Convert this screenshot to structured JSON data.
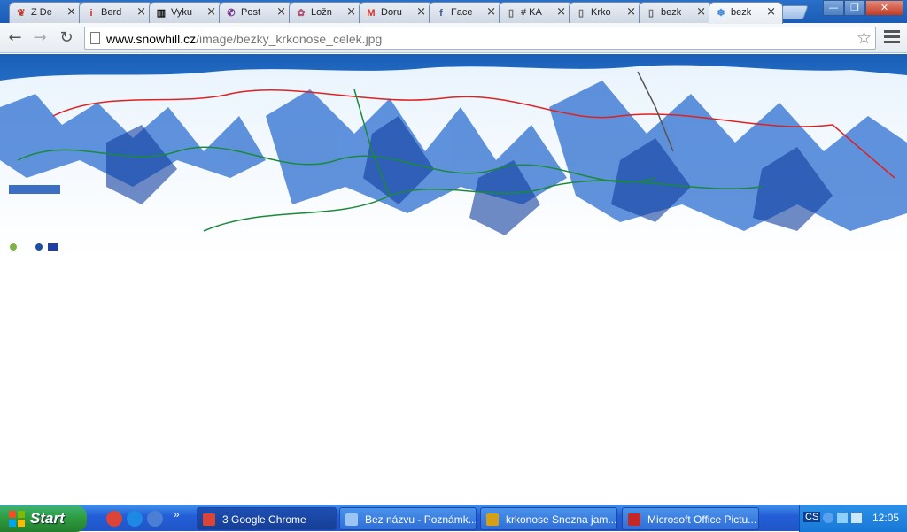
{
  "browser": {
    "tabs": [
      {
        "title": "Z De",
        "icon": "bookmark-icon",
        "icon_glyph": "❦",
        "icon_color": "#c0392b"
      },
      {
        "title": "Berd",
        "icon": "info-icon",
        "icon_glyph": "i",
        "icon_color": "#d32f2f"
      },
      {
        "title": "Vyku",
        "icon": "barcode-icon",
        "icon_glyph": "▥",
        "icon_color": "#000000"
      },
      {
        "title": "Post",
        "icon": "viber-icon",
        "icon_glyph": "✆",
        "icon_color": "#7b2a8e"
      },
      {
        "title": "Ložn",
        "icon": "pig-icon",
        "icon_glyph": "✿",
        "icon_color": "#b05070"
      },
      {
        "title": "Doru",
        "icon": "gmail-icon",
        "icon_glyph": "M",
        "icon_color": "#d93025"
      },
      {
        "title": "Face",
        "icon": "facebook-icon",
        "icon_glyph": "f",
        "icon_color": "#3b5998"
      },
      {
        "title": "# KA",
        "icon": "page-icon",
        "icon_glyph": "▯",
        "icon_color": "#666666"
      },
      {
        "title": "Krko",
        "icon": "page-icon",
        "icon_glyph": "▯",
        "icon_color": "#666666"
      },
      {
        "title": "bezk",
        "icon": "page-icon",
        "icon_glyph": "▯",
        "icon_color": "#666666"
      },
      {
        "title": "bezk",
        "icon": "snowflake-icon",
        "icon_glyph": "❄",
        "icon_color": "#2a7fd4",
        "active": true
      }
    ],
    "url_host": "www.snowhill.cz",
    "url_path": "/image/bezky_krkonose_celek.jpg",
    "window_controls": {
      "minimize": "—",
      "restore": "❐",
      "close": "✕"
    }
  },
  "taskbar": {
    "start_label": "Start",
    "quick_launch": [
      {
        "icon": "chrome-icon",
        "color": "#db4437"
      },
      {
        "icon": "ie-icon",
        "color": "#1e88e5"
      },
      {
        "icon": "ie-alt-icon",
        "color": "#4a7fd4"
      }
    ],
    "overflow": "»",
    "tasks": [
      {
        "label": "3  Google Chrome",
        "icon": "chrome-icon",
        "color": "#db4437",
        "active": true
      },
      {
        "label": "Bez názvu - Poznámk...",
        "icon": "notepad-icon",
        "color": "#9cc4f0"
      },
      {
        "label": "krkonose Snezna jam...",
        "icon": "image-icon",
        "color": "#d4a017"
      },
      {
        "label": "Microsoft Office Pictu...",
        "icon": "office-picture-icon",
        "color": "#c62828"
      }
    ],
    "lang": "CS",
    "clock": "12:05"
  }
}
